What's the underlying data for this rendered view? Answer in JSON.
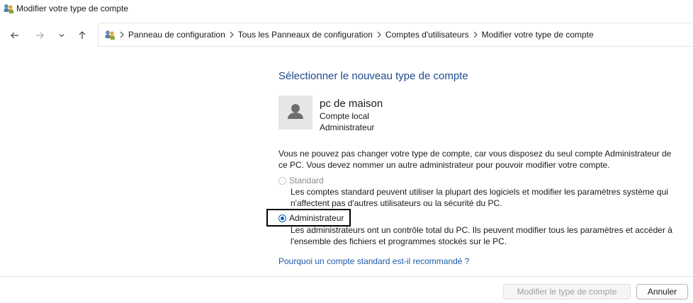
{
  "window": {
    "title": "Modifier votre type de compte"
  },
  "nav": {
    "back_icon": "arrow-left-icon",
    "forward_icon": "arrow-right-icon",
    "recent_icon": "chevron-down-icon",
    "up_icon": "arrow-up-icon"
  },
  "breadcrumb": {
    "items": [
      "Panneau de configuration",
      "Tous les Panneaux de configuration",
      "Comptes d'utilisateurs",
      "Modifier votre type de compte"
    ]
  },
  "main": {
    "heading": "Sélectionner le nouveau type de compte",
    "account": {
      "name": "pc de maison",
      "type": "Compte local",
      "role": "Administrateur"
    },
    "note": "Vous ne pouvez pas changer votre type de compte, car vous disposez du seul compte Administrateur de ce PC. Vous devez nommer un autre administrateur pour pouvoir modifier votre compte.",
    "options": [
      {
        "label": "Standard",
        "selected": false,
        "disabled": true,
        "description": "Les comptes standard peuvent utiliser la plupart des logiciels et modifier les paramètres système qui n'affectent pas d'autres utilisateurs ou la sécurité du PC."
      },
      {
        "label": "Administrateur",
        "selected": true,
        "disabled": false,
        "description": "Les administrateurs ont un contrôle total du PC. Ils peuvent modifier tous les paramètres et accéder à l'ensemble des fichiers et programmes stockés sur le PC."
      }
    ],
    "help_link": "Pourquoi un compte standard est-il recommandé ?"
  },
  "footer": {
    "change_label": "Modifier le type de compte",
    "cancel_label": "Annuler"
  },
  "colors": {
    "heading": "#1e4a8c",
    "link": "#1e5aa8",
    "radio_accent": "#0a5fb4"
  }
}
